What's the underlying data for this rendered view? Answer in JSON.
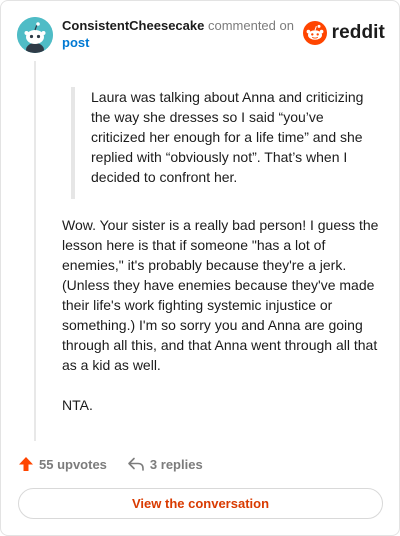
{
  "header": {
    "username": "ConsistentCheesecake",
    "action_text": "commented on",
    "post_link": "post",
    "brand": "reddit"
  },
  "quote": {
    "text": "Laura was talking about Anna and criticizing the way she dresses so I said “you’ve criticized her enough for a life time” and she replied with “obviously not”. That’s when I decided to confront her."
  },
  "comment": {
    "paragraphs": [
      "Wow. Your sister is a really bad person! I guess the lesson here is that if someone \"has a lot of enemies,\" it's probably because they're a jerk. (Unless they have enemies because they've made their life's work fighting systemic injustice or something.) I'm so sorry you and Anna are going through all this, and that Anna went through all that as a kid as well.",
      "NTA."
    ]
  },
  "actions": {
    "upvotes_label": "55 upvotes",
    "replies_label": "3 replies"
  },
  "footer": {
    "view_button": "View the conversation"
  },
  "colors": {
    "accent": "#d93a00",
    "reddit_orange": "#ff4500",
    "link_blue": "#0079d3",
    "avatar_bg": "#4fbcc6"
  },
  "icons": {
    "avatar": "snoo-avatar",
    "brand": "reddit-logo-icon",
    "upvote": "upvote-arrow-icon",
    "reply": "reply-arrow-icon"
  }
}
